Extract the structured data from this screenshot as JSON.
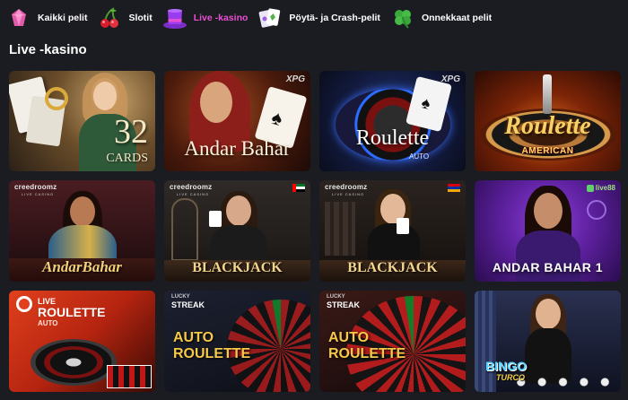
{
  "nav": {
    "items": [
      {
        "label": "Kaikki pelit",
        "icon": "gem-icon",
        "active": false
      },
      {
        "label": "Slotit",
        "icon": "cherry-icon",
        "active": false
      },
      {
        "label": "Live -kasino",
        "icon": "top-hat-icon",
        "active": true
      },
      {
        "label": "Pöytä- ja Crash-pelit",
        "icon": "cards-icon",
        "active": false
      },
      {
        "label": "Onnekkaat pelit",
        "icon": "clover-icon",
        "active": false
      }
    ]
  },
  "section": {
    "title": "Live -kasino"
  },
  "tiles": [
    {
      "title_main": "32",
      "title_sub": "CARDS"
    },
    {
      "title": "Andar Bahar",
      "badge": "XPG"
    },
    {
      "title": "Roulette",
      "subtitle": "AUTO",
      "badge": "XPG"
    },
    {
      "title": "Roulette",
      "subtitle": "AMERICAN"
    },
    {
      "title": "AndarBahar",
      "brand": "creedroomz",
      "brand_sub": "LIVE CASINO"
    },
    {
      "title": "BLACKJACK",
      "brand": "creedroomz",
      "brand_sub": "LIVE CASINO"
    },
    {
      "title": "BLACKJACK",
      "brand": "creedroomz",
      "brand_sub": "LIVE CASINO"
    },
    {
      "title": "ANDAR BAHAR 1",
      "badge": "live88"
    },
    {
      "title_line1": "LIVE",
      "title_line2": "ROULETTE",
      "subtitle": "AUTO"
    },
    {
      "brand_line1": "LUCKY",
      "brand_line2": "STREAK",
      "title_line1": "AUTO",
      "title_line2": "ROULETTE"
    },
    {
      "brand_line1": "LUCKY",
      "brand_line2": "STREAK",
      "title_line1": "AUTO",
      "title_line2": "ROULETTE"
    },
    {
      "title": "BINGO",
      "subtitle": "TURCO"
    }
  ]
}
